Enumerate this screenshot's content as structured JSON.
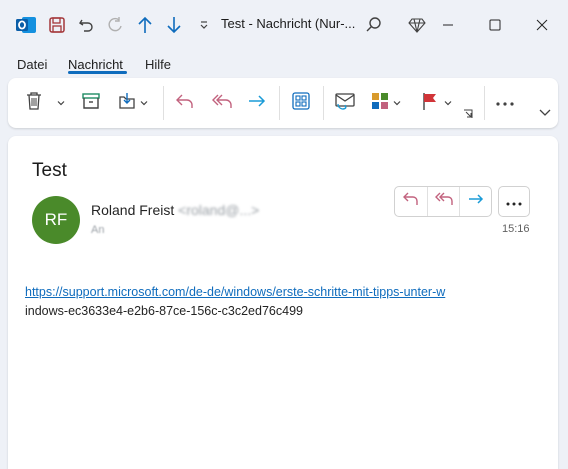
{
  "window": {
    "title": "Test  -  Nachricht (Nur-..."
  },
  "menu": {
    "items": [
      "Datei",
      "Nachricht",
      "Hilfe"
    ],
    "active": "Nachricht"
  },
  "ribbon": {
    "buttons": [
      "delete-icon",
      "archive-icon",
      "move-icon",
      "reply-icon",
      "reply-all-icon",
      "forward-icon",
      "apps-icon",
      "read-unread-icon",
      "categorize-icon",
      "flag-icon",
      "more-icon"
    ]
  },
  "message": {
    "subject": "Test",
    "avatar_initials": "RF",
    "avatar_color": "#4a8a2a",
    "sender_name": "Roland Freist",
    "sender_email": "<roland@...>",
    "to_label": "An",
    "time": "15:16",
    "body_link": "https://support.microsoft.com/de-de/windows/erste-schritte-mit-tipps-unter-w",
    "body_link_rest": "indows-ec3633e4-e2b6-87ce-156c-c3c2ed76c499"
  },
  "colors": {
    "accent": "#0f6cbd",
    "reply": "#c2627e",
    "forward": "#1a9bd7"
  }
}
